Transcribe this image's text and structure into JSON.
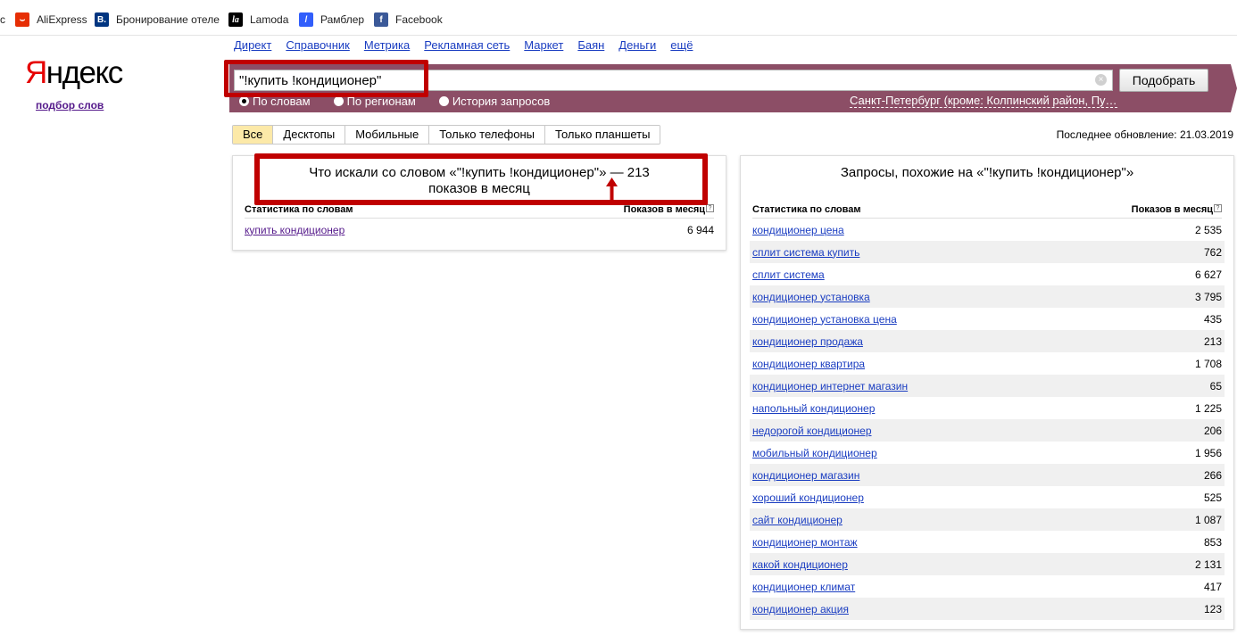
{
  "bookmarks": [
    {
      "label": "AliExpress",
      "icon": "aliexpress-icon"
    },
    {
      "label": "Бронирование отеле",
      "icon": "booking-icon"
    },
    {
      "label": "Lamoda",
      "icon": "lamoda-icon"
    },
    {
      "label": "Рамблер",
      "icon": "rambler-icon"
    },
    {
      "label": "Facebook",
      "icon": "facebook-icon"
    }
  ],
  "bookmark_glyphs": {
    "ali": "⌣",
    "booking": "B.",
    "lamoda": "la",
    "rambler": "/",
    "facebook": "f"
  },
  "bookmark_partial": "с",
  "topnav": [
    "Директ",
    "Справочник",
    "Метрика",
    "Рекламная сеть",
    "Маркет",
    "Баян",
    "Деньги",
    "ещё"
  ],
  "logo": {
    "first": "Я",
    "rest": "ндекс",
    "subtitle": "подбор слов"
  },
  "search": {
    "query": "\"!купить !кондиционер\"",
    "submit_label": "Подобрать",
    "radios": [
      {
        "label": "По словам",
        "checked": true
      },
      {
        "label": "По регионам",
        "checked": false
      },
      {
        "label": "История запросов",
        "checked": false
      }
    ],
    "region": "Санкт-Петербург (кроме: Колпинский район, Пу…"
  },
  "tabs": [
    "Все",
    "Десктопы",
    "Мобильные",
    "Только телефоны",
    "Только планшеты"
  ],
  "active_tab": "Все",
  "last_update": "Последнее обновление: 21.03.2019",
  "left_panel": {
    "title": "Что искали со словом «\"!купить !кондиционер\"» — 213 показов в месяц",
    "col_words": "Статистика по словам",
    "col_shows": "Показов в месяц",
    "rows": [
      {
        "phrase": "купить кондиционер",
        "count": "6 944"
      }
    ]
  },
  "right_panel": {
    "title": "Запросы, похожие на «\"!купить !кондиционер\"»",
    "col_words": "Статистика по словам",
    "col_shows": "Показов в месяц",
    "rows": [
      {
        "phrase": "кондиционер цена",
        "count": "2 535"
      },
      {
        "phrase": "сплит система купить",
        "count": "762"
      },
      {
        "phrase": "сплит система",
        "count": "6 627"
      },
      {
        "phrase": "кондиционер установка",
        "count": "3 795"
      },
      {
        "phrase": "кондиционер установка цена",
        "count": "435"
      },
      {
        "phrase": "кондиционер продажа",
        "count": "213"
      },
      {
        "phrase": "кондиционер квартира",
        "count": "1 708"
      },
      {
        "phrase": "кондиционер интернет магазин",
        "count": "65"
      },
      {
        "phrase": "напольный кондиционер",
        "count": "1 225"
      },
      {
        "phrase": "недорогой кондиционер",
        "count": "206"
      },
      {
        "phrase": "мобильный кондиционер",
        "count": "1 956"
      },
      {
        "phrase": "кондиционер магазин",
        "count": "266"
      },
      {
        "phrase": "хороший кондиционер",
        "count": "525"
      },
      {
        "phrase": "сайт кондиционер",
        "count": "1 087"
      },
      {
        "phrase": "кондиционер монтаж",
        "count": "853"
      },
      {
        "phrase": "какой кондиционер",
        "count": "2 131"
      },
      {
        "phrase": "кондиционер климат",
        "count": "417"
      },
      {
        "phrase": "кондиционер акция",
        "count": "123"
      }
    ]
  },
  "colors": {
    "accent_band": "#8c4e66",
    "highlight_frame": "#c00000",
    "link": "#1a3dc1",
    "active_tab": "#fce9a8"
  }
}
